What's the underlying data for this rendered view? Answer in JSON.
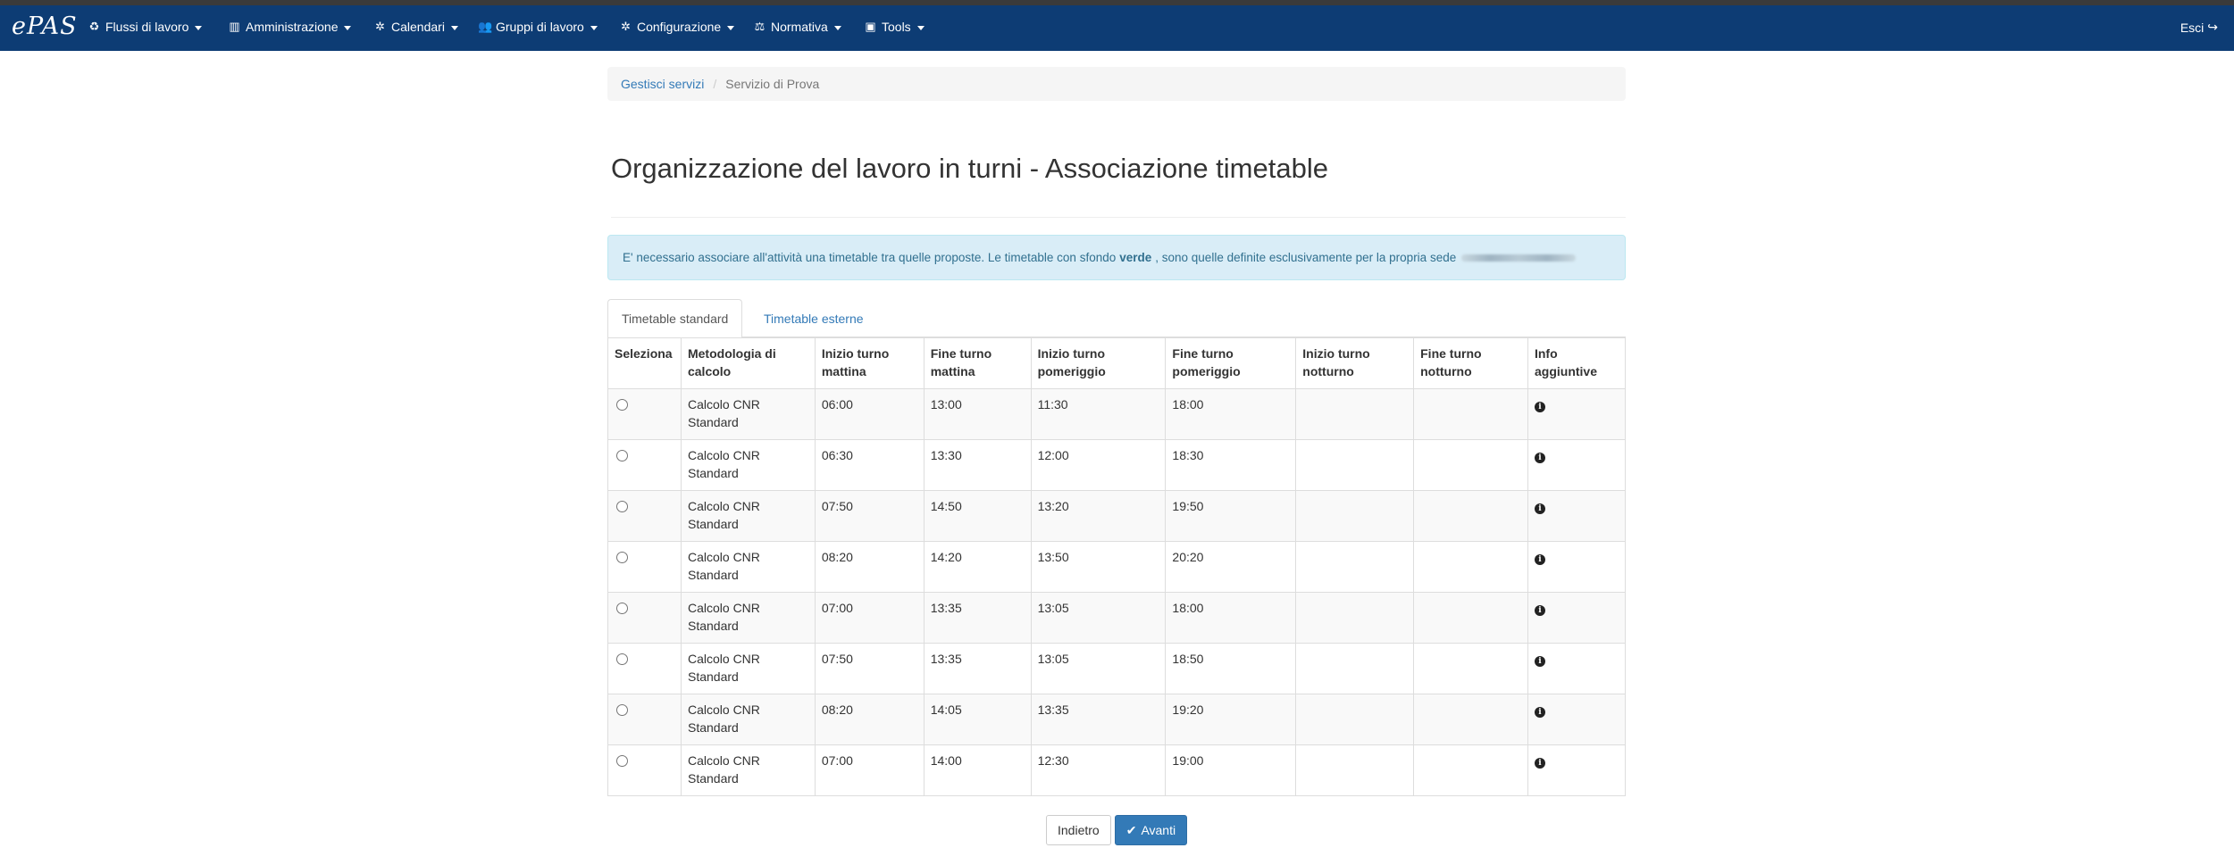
{
  "app": {
    "brand": "ePAS"
  },
  "nav": {
    "items": [
      {
        "label": "Flussi di lavoro",
        "icon": "recycle-icon",
        "glyph": "♻"
      },
      {
        "label": "Amministrazione",
        "icon": "bar-chart-icon",
        "glyph": "▥"
      },
      {
        "label": "Calendari",
        "icon": "gear-icon",
        "glyph": "✲"
      },
      {
        "label": "Gruppi di lavoro",
        "icon": "users-icon",
        "glyph": "👥"
      },
      {
        "label": "Configurazione",
        "icon": "gear-icon",
        "glyph": "✲"
      },
      {
        "label": "Normativa",
        "icon": "balance-scale-icon",
        "glyph": "⚖"
      },
      {
        "label": "Tools",
        "icon": "toolbox-icon",
        "glyph": "▣"
      }
    ],
    "logout": {
      "label": "Esci",
      "icon": "sign-out-icon",
      "glyph": "↪"
    }
  },
  "breadcrumb": {
    "link": "Gestisci servizi",
    "current": "Servizio di Prova"
  },
  "page": {
    "title": "Organizzazione del lavoro in turni - Associazione timetable"
  },
  "alert": {
    "before": "E' necessario associare all'attività una timetable tra quelle proposte. Le timetable con sfondo",
    "bold": "verde",
    "after": ", sono quelle definite esclusivamente per la propria sede"
  },
  "tabs": [
    {
      "label": "Timetable standard",
      "active": true
    },
    {
      "label": "Timetable esterne",
      "active": false
    }
  ],
  "table": {
    "headers": [
      [
        "Seleziona"
      ],
      [
        "Metodologia di",
        "calcolo"
      ],
      [
        "Inizio turno",
        "mattina"
      ],
      [
        "Fine turno",
        "mattina"
      ],
      [
        "Inizio turno",
        "pomeriggio"
      ],
      [
        "Fine turno",
        "pomeriggio"
      ],
      [
        "Inizio turno",
        "notturno"
      ],
      [
        "Fine turno",
        "notturno"
      ],
      [
        "Info",
        "aggiuntive"
      ]
    ],
    "rows": [
      {
        "method": [
          "Calcolo CNR",
          "Standard"
        ],
        "start_morning": "06:00",
        "end_morning": "13:00",
        "start_afternoon": "11:30",
        "end_afternoon": "18:00",
        "start_night": "",
        "end_night": ""
      },
      {
        "method": [
          "Calcolo CNR",
          "Standard"
        ],
        "start_morning": "06:30",
        "end_morning": "13:30",
        "start_afternoon": "12:00",
        "end_afternoon": "18:30",
        "start_night": "",
        "end_night": ""
      },
      {
        "method": [
          "Calcolo CNR",
          "Standard"
        ],
        "start_morning": "07:50",
        "end_morning": "14:50",
        "start_afternoon": "13:20",
        "end_afternoon": "19:50",
        "start_night": "",
        "end_night": ""
      },
      {
        "method": [
          "Calcolo CNR",
          "Standard"
        ],
        "start_morning": "08:20",
        "end_morning": "14:20",
        "start_afternoon": "13:50",
        "end_afternoon": "20:20",
        "start_night": "",
        "end_night": ""
      },
      {
        "method": [
          "Calcolo CNR",
          "Standard"
        ],
        "start_morning": "07:00",
        "end_morning": "13:35",
        "start_afternoon": "13:05",
        "end_afternoon": "18:00",
        "start_night": "",
        "end_night": ""
      },
      {
        "method": [
          "Calcolo CNR",
          "Standard"
        ],
        "start_morning": "07:50",
        "end_morning": "13:35",
        "start_afternoon": "13:05",
        "end_afternoon": "18:50",
        "start_night": "",
        "end_night": ""
      },
      {
        "method": [
          "Calcolo CNR",
          "Standard"
        ],
        "start_morning": "08:20",
        "end_morning": "14:05",
        "start_afternoon": "13:35",
        "end_afternoon": "19:20",
        "start_night": "",
        "end_night": ""
      },
      {
        "method": [
          "Calcolo CNR",
          "Standard"
        ],
        "start_morning": "07:00",
        "end_morning": "14:00",
        "start_afternoon": "12:30",
        "end_afternoon": "19:00",
        "start_night": "",
        "end_night": ""
      }
    ]
  },
  "buttons": {
    "back": {
      "label": "Indietro"
    },
    "next": {
      "label": "Avanti",
      "icon": "check-icon",
      "glyph": "✔"
    }
  },
  "colors": {
    "navbar": "#0d3c74",
    "primary": "#337ab7",
    "alert_bg": "#d9edf7",
    "alert_text": "#31708f"
  }
}
